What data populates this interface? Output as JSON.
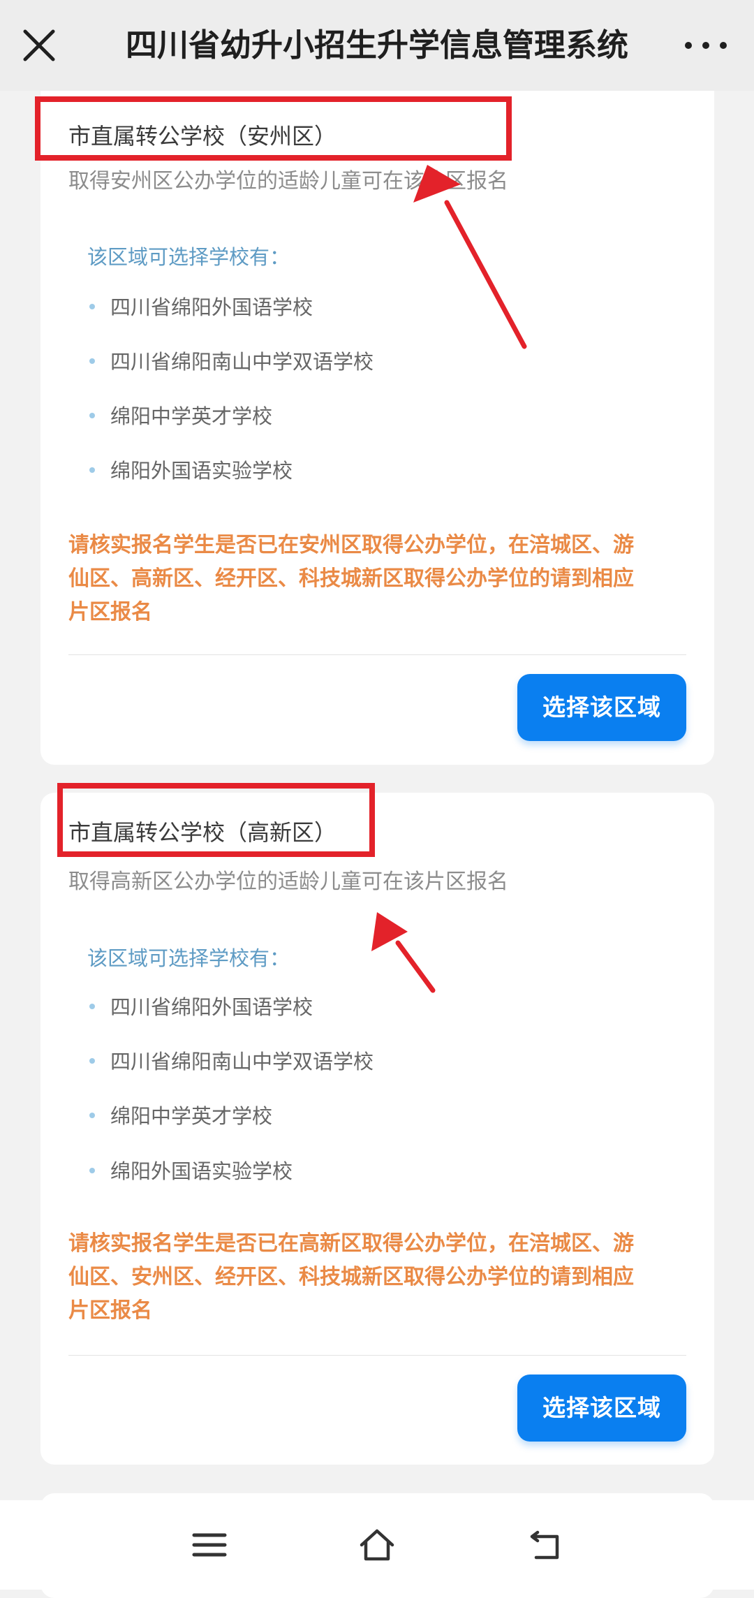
{
  "header": {
    "title": "四川省幼升小招生升学信息管理系统",
    "close_icon": "close-icon",
    "more_icon": "more-horizontal-icon"
  },
  "cards": [
    {
      "title": "市直属转公学校（安州区）",
      "description": "取得安州区公办学位的适龄儿童可在该片区报名",
      "schools_heading": "该区域可选择学校有：",
      "schools": [
        "四川省绵阳外国语学校",
        "四川省绵阳南山中学双语学校",
        "绵阳中学英才学校",
        "绵阳外国语实验学校"
      ],
      "notice_lines": [
        "请核实报名学生是否已在安州区取得公办学位，在涪城区、游",
        "仙区、高新区、经开区、科技城新区取得公办学位的请到相应",
        "片区报名"
      ],
      "button_label": "选择该区域"
    },
    {
      "title": "市直属转公学校（高新区）",
      "description": "取得高新区公办学位的适龄儿童可在该片区报名",
      "schools_heading": "该区域可选择学校有：",
      "schools": [
        "四川省绵阳外国语学校",
        "四川省绵阳南山中学双语学校",
        "绵阳中学英才学校",
        "绵阳外国语实验学校"
      ],
      "notice_lines": [
        "请核实报名学生是否已在高新区取得公办学位，在涪城区、游",
        "仙区、安州区、经开区、科技城新区取得公办学位的请到相应",
        "片区报名"
      ],
      "button_label": "选择该区域"
    }
  ],
  "bottom_nav": {
    "icons": [
      "menu-icon",
      "home-icon",
      "back-icon"
    ]
  },
  "colors": {
    "accent": "#0a7ff0",
    "notice": "#ea8a46",
    "heading": "#5e9bc4",
    "annotation": "#e3222a"
  }
}
